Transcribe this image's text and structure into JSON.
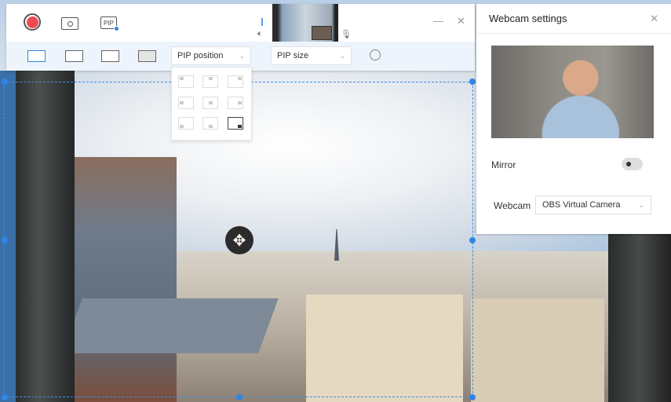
{
  "toolbar": {
    "record_icon": "record-icon",
    "screenshot_icon": "camera-icon",
    "pip_label": "PIP",
    "minimize": "—",
    "close": "✕"
  },
  "modes": [
    "pip-mode",
    "side-by-side-mode",
    "webcam-only-mode",
    "screen-only-mode"
  ],
  "pip_position": {
    "label": "PIP position",
    "selected": "bottom-right",
    "options": [
      "top-left",
      "top-center",
      "top-right",
      "middle-left",
      "center",
      "middle-right",
      "bottom-left",
      "bottom-center",
      "bottom-right"
    ]
  },
  "pip_size": {
    "label": "PIP size"
  },
  "webcam_settings": {
    "title": "Webcam settings",
    "close": "✕",
    "mirror_label": "Mirror",
    "mirror_on": false,
    "webcam_label": "Webcam",
    "webcam_value": "OBS Virtual Camera"
  },
  "colors": {
    "accent": "#2f86e6",
    "record": "#ef4a4f"
  }
}
